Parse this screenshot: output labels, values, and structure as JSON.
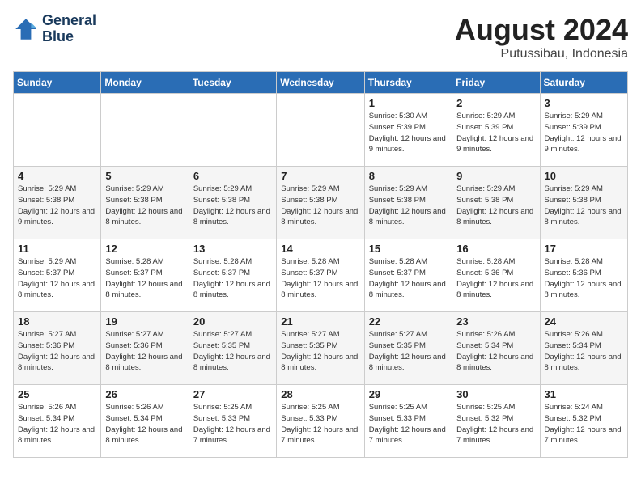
{
  "header": {
    "logo_line1": "General",
    "logo_line2": "Blue",
    "month_year": "August 2024",
    "location": "Putussibau, Indonesia"
  },
  "weekdays": [
    "Sunday",
    "Monday",
    "Tuesday",
    "Wednesday",
    "Thursday",
    "Friday",
    "Saturday"
  ],
  "weeks": [
    [
      {
        "day": "",
        "info": ""
      },
      {
        "day": "",
        "info": ""
      },
      {
        "day": "",
        "info": ""
      },
      {
        "day": "",
        "info": ""
      },
      {
        "day": "1",
        "info": "Sunrise: 5:30 AM\nSunset: 5:39 PM\nDaylight: 12 hours\nand 9 minutes."
      },
      {
        "day": "2",
        "info": "Sunrise: 5:29 AM\nSunset: 5:39 PM\nDaylight: 12 hours\nand 9 minutes."
      },
      {
        "day": "3",
        "info": "Sunrise: 5:29 AM\nSunset: 5:39 PM\nDaylight: 12 hours\nand 9 minutes."
      }
    ],
    [
      {
        "day": "4",
        "info": "Sunrise: 5:29 AM\nSunset: 5:38 PM\nDaylight: 12 hours\nand 9 minutes."
      },
      {
        "day": "5",
        "info": "Sunrise: 5:29 AM\nSunset: 5:38 PM\nDaylight: 12 hours\nand 8 minutes."
      },
      {
        "day": "6",
        "info": "Sunrise: 5:29 AM\nSunset: 5:38 PM\nDaylight: 12 hours\nand 8 minutes."
      },
      {
        "day": "7",
        "info": "Sunrise: 5:29 AM\nSunset: 5:38 PM\nDaylight: 12 hours\nand 8 minutes."
      },
      {
        "day": "8",
        "info": "Sunrise: 5:29 AM\nSunset: 5:38 PM\nDaylight: 12 hours\nand 8 minutes."
      },
      {
        "day": "9",
        "info": "Sunrise: 5:29 AM\nSunset: 5:38 PM\nDaylight: 12 hours\nand 8 minutes."
      },
      {
        "day": "10",
        "info": "Sunrise: 5:29 AM\nSunset: 5:38 PM\nDaylight: 12 hours\nand 8 minutes."
      }
    ],
    [
      {
        "day": "11",
        "info": "Sunrise: 5:29 AM\nSunset: 5:37 PM\nDaylight: 12 hours\nand 8 minutes."
      },
      {
        "day": "12",
        "info": "Sunrise: 5:28 AM\nSunset: 5:37 PM\nDaylight: 12 hours\nand 8 minutes."
      },
      {
        "day": "13",
        "info": "Sunrise: 5:28 AM\nSunset: 5:37 PM\nDaylight: 12 hours\nand 8 minutes."
      },
      {
        "day": "14",
        "info": "Sunrise: 5:28 AM\nSunset: 5:37 PM\nDaylight: 12 hours\nand 8 minutes."
      },
      {
        "day": "15",
        "info": "Sunrise: 5:28 AM\nSunset: 5:37 PM\nDaylight: 12 hours\nand 8 minutes."
      },
      {
        "day": "16",
        "info": "Sunrise: 5:28 AM\nSunset: 5:36 PM\nDaylight: 12 hours\nand 8 minutes."
      },
      {
        "day": "17",
        "info": "Sunrise: 5:28 AM\nSunset: 5:36 PM\nDaylight: 12 hours\nand 8 minutes."
      }
    ],
    [
      {
        "day": "18",
        "info": "Sunrise: 5:27 AM\nSunset: 5:36 PM\nDaylight: 12 hours\nand 8 minutes."
      },
      {
        "day": "19",
        "info": "Sunrise: 5:27 AM\nSunset: 5:36 PM\nDaylight: 12 hours\nand 8 minutes."
      },
      {
        "day": "20",
        "info": "Sunrise: 5:27 AM\nSunset: 5:35 PM\nDaylight: 12 hours\nand 8 minutes."
      },
      {
        "day": "21",
        "info": "Sunrise: 5:27 AM\nSunset: 5:35 PM\nDaylight: 12 hours\nand 8 minutes."
      },
      {
        "day": "22",
        "info": "Sunrise: 5:27 AM\nSunset: 5:35 PM\nDaylight: 12 hours\nand 8 minutes."
      },
      {
        "day": "23",
        "info": "Sunrise: 5:26 AM\nSunset: 5:34 PM\nDaylight: 12 hours\nand 8 minutes."
      },
      {
        "day": "24",
        "info": "Sunrise: 5:26 AM\nSunset: 5:34 PM\nDaylight: 12 hours\nand 8 minutes."
      }
    ],
    [
      {
        "day": "25",
        "info": "Sunrise: 5:26 AM\nSunset: 5:34 PM\nDaylight: 12 hours\nand 8 minutes."
      },
      {
        "day": "26",
        "info": "Sunrise: 5:26 AM\nSunset: 5:34 PM\nDaylight: 12 hours\nand 8 minutes."
      },
      {
        "day": "27",
        "info": "Sunrise: 5:25 AM\nSunset: 5:33 PM\nDaylight: 12 hours\nand 7 minutes."
      },
      {
        "day": "28",
        "info": "Sunrise: 5:25 AM\nSunset: 5:33 PM\nDaylight: 12 hours\nand 7 minutes."
      },
      {
        "day": "29",
        "info": "Sunrise: 5:25 AM\nSunset: 5:33 PM\nDaylight: 12 hours\nand 7 minutes."
      },
      {
        "day": "30",
        "info": "Sunrise: 5:25 AM\nSunset: 5:32 PM\nDaylight: 12 hours\nand 7 minutes."
      },
      {
        "day": "31",
        "info": "Sunrise: 5:24 AM\nSunset: 5:32 PM\nDaylight: 12 hours\nand 7 minutes."
      }
    ]
  ]
}
